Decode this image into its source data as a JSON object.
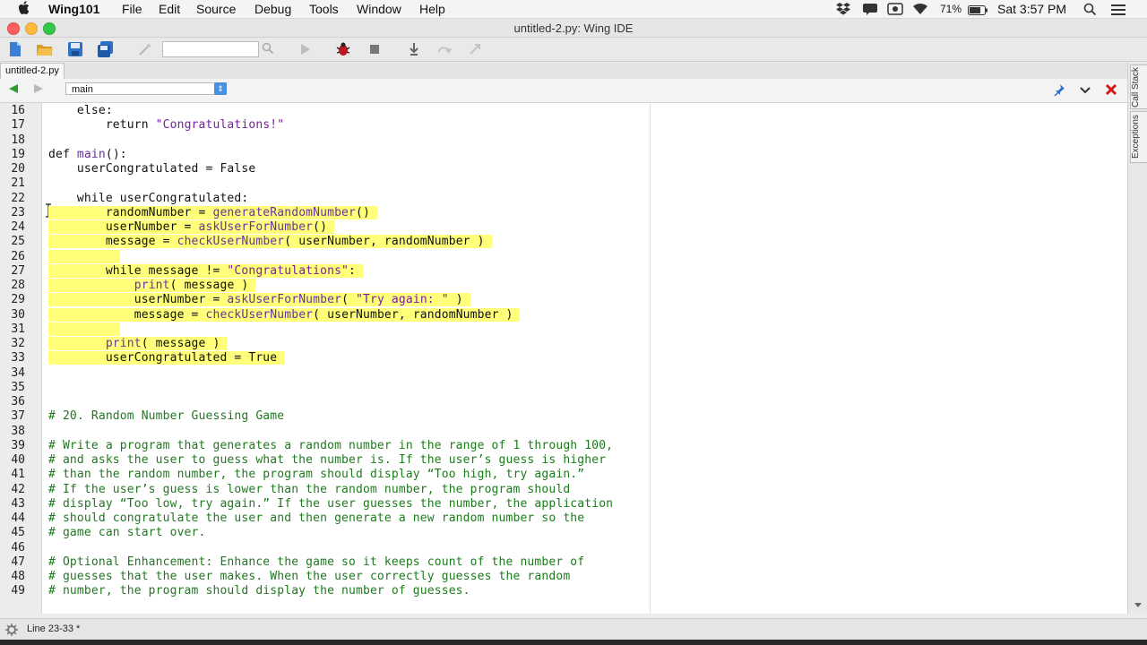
{
  "menubar": {
    "app_name": "Wing101",
    "menus": [
      "File",
      "Edit",
      "Source",
      "Debug",
      "Tools",
      "Window",
      "Help"
    ],
    "battery": "71%",
    "clock": "Sat 3:57 PM"
  },
  "window": {
    "title": "untitled-2.py: Wing IDE"
  },
  "tab": {
    "label": "untitled-2.py"
  },
  "nav": {
    "scope": "main"
  },
  "side_tabs": [
    "Call Stack",
    "Exceptions"
  ],
  "editor": {
    "line_numbers": [
      "16",
      "17",
      "18",
      "19",
      "20",
      "21",
      "22",
      "23",
      "24",
      "25",
      "26",
      "27",
      "28",
      "29",
      "30",
      "31",
      "32",
      "33",
      "34",
      "35",
      "36",
      "37",
      "38",
      "39",
      "40",
      "41",
      "42",
      "43",
      "44",
      "45",
      "46",
      "47",
      "48",
      "49"
    ],
    "lines": [
      "    else:",
      "        return \"Congratulations!\"",
      "",
      "def main():",
      "    userCongratulated = False",
      "",
      "    while userCongratulated:",
      "        randomNumber = generateRandomNumber()",
      "        userNumber = askUserForNumber()",
      "        message = checkUserNumber( userNumber, randomNumber )",
      "",
      "        while message != \"Congratulations\":",
      "            print( message )",
      "            userNumber = askUserForNumber( \"Try again: \" )",
      "            message = checkUserNumber( userNumber, randomNumber )",
      "",
      "        print( message )",
      "        userCongratulated = True",
      "",
      "",
      "",
      "# 20. Random Number Guessing Game",
      "",
      "# Write a program that generates a random number in the range of 1 through 100,",
      "# and asks the user to guess what the number is. If the user’s guess is higher",
      "# than the random number, the program should display “Too high, try again.”",
      "# If the user’s guess is lower than the random number, the program should",
      "# display “Too low, try again.” If the user guesses the number, the application",
      "# should congratulate the user and then generate a new random number so the",
      "# game can start over.",
      "",
      "# Optional Enhancement: Enhance the game so it keeps count of the number of",
      "# guesses that the user makes. When the user correctly guesses the random",
      "# number, the program should display the number of guesses."
    ]
  },
  "status": {
    "text": "Line 23-33 *"
  },
  "colors": {
    "highlight": "#ffff7a",
    "comment": "#1f7a1f",
    "string": "#7a1ea1"
  }
}
